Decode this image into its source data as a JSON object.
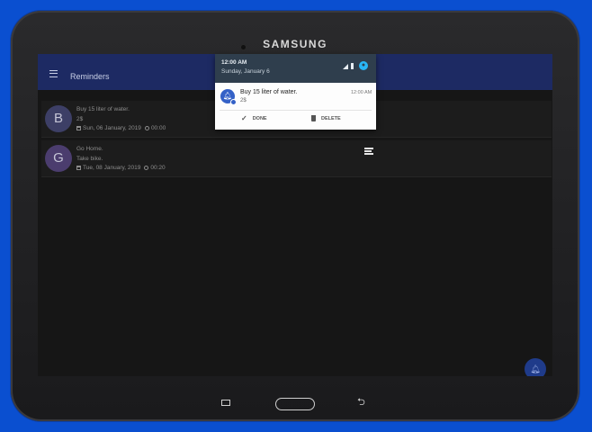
{
  "device": {
    "brand": "SAMSUNG"
  },
  "app": {
    "title": "Reminders",
    "reminders": [
      {
        "initial": "B",
        "title": "Buy 15 liter of water.",
        "note": "2$",
        "date": "Sun, 06 January, 2019",
        "time": "00:00"
      },
      {
        "initial": "G",
        "title": "Go Home.",
        "note": "Take bike.",
        "date": "Tue, 08 January, 2019",
        "time": "00:20"
      }
    ],
    "fab_icon": "bell-icon"
  },
  "notification_shade": {
    "time": "12:00 AM",
    "date": "Sunday, January 6",
    "notification": {
      "title": "Buy 15 liter of water.",
      "body": "2$",
      "time": "12:00 AM",
      "actions": {
        "done": "DONE",
        "delete": "DELETE"
      }
    }
  },
  "colors": {
    "background": "#0a4fd0",
    "appbar": "#1d2a63",
    "notification_accent": "#3461c7"
  }
}
